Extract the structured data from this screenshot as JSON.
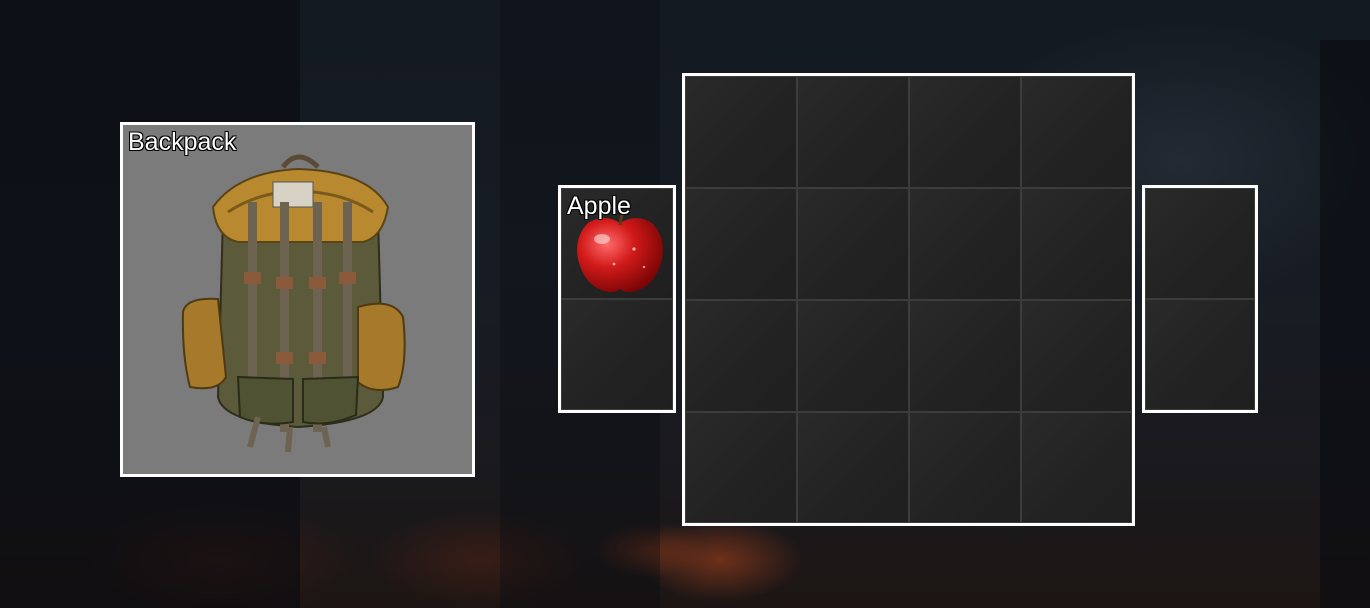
{
  "equipment": {
    "backpack_slot": {
      "label": "Backpack",
      "item_icon": "backpack-icon"
    }
  },
  "pockets": {
    "slots": [
      {
        "label": "Apple",
        "item_icon": "apple-icon"
      },
      {
        "label": "",
        "item_icon": ""
      }
    ]
  },
  "backpack_storage": {
    "rows": 4,
    "columns": 4
  },
  "side_storage": {
    "rows": 2,
    "columns": 1
  },
  "colors": {
    "slot_border": "#ffffff",
    "cell_background": "#242424",
    "equipment_background": "#7b7b7b"
  }
}
